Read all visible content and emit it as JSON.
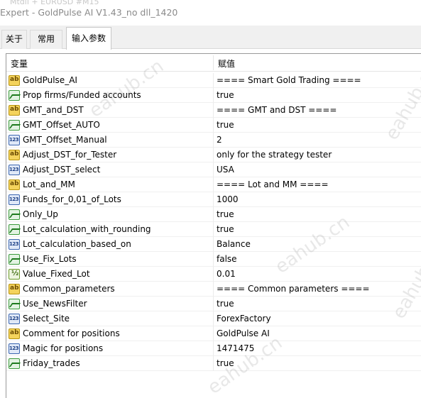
{
  "window": {
    "ghost_text": "Mtdll + EURUSD  #M15",
    "title": "Expert - GoldPulse AI V1.43_no dll_1420"
  },
  "tabs": [
    {
      "label": "关于"
    },
    {
      "label": "常用"
    },
    {
      "label": "输入参数"
    }
  ],
  "table": {
    "headers": {
      "variable": "变量",
      "value": "赋值"
    },
    "rows": [
      {
        "icon": "ab-icon",
        "name": "GoldPulse_AI",
        "value": "==== Smart Gold Trading ===="
      },
      {
        "icon": "bool-icon",
        "name": "Prop firms/Funded accounts",
        "value": "true"
      },
      {
        "icon": "ab-icon",
        "name": "GMT_and_DST",
        "value": "==== GMT and DST ===="
      },
      {
        "icon": "bool-icon",
        "name": "GMT_Offset_AUTO",
        "value": "true"
      },
      {
        "icon": "int-icon",
        "name": "GMT_Offset_Manual",
        "value": "2"
      },
      {
        "icon": "ab-icon",
        "name": "Adjust_DST_for_Tester",
        "value": "only for the strategy tester"
      },
      {
        "icon": "int-icon",
        "name": "Adjust_DST_select",
        "value": "USA"
      },
      {
        "icon": "ab-icon",
        "name": "Lot_and_MM",
        "value": "==== Lot and MM ===="
      },
      {
        "icon": "int-icon",
        "name": "Funds_for_0,01_of_Lots",
        "value": "1000"
      },
      {
        "icon": "bool-icon",
        "name": "Only_Up",
        "value": "true"
      },
      {
        "icon": "bool-icon",
        "name": "Lot_calculation_with_rounding",
        "value": "true"
      },
      {
        "icon": "int-icon",
        "name": "Lot_calculation_based_on",
        "value": "Balance"
      },
      {
        "icon": "bool-icon",
        "name": "Use_Fix_Lots",
        "value": "false"
      },
      {
        "icon": "double-icon",
        "name": "Value_Fixed_Lot",
        "value": "0.01"
      },
      {
        "icon": "ab-icon",
        "name": "Common_parameters",
        "value": "==== Common parameters ===="
      },
      {
        "icon": "bool-icon",
        "name": "Use_NewsFilter",
        "value": "true"
      },
      {
        "icon": "int-icon",
        "name": "Select_Site",
        "value": "ForexFactory"
      },
      {
        "icon": "ab-icon",
        "name": "Comment for positions",
        "value": "GoldPulse AI"
      },
      {
        "icon": "int-icon",
        "name": "Magic for positions",
        "value": "1471475"
      },
      {
        "icon": "bool-icon",
        "name": "Friday_trades",
        "value": "true"
      }
    ]
  },
  "watermark": {
    "text": "eahub.cn"
  }
}
